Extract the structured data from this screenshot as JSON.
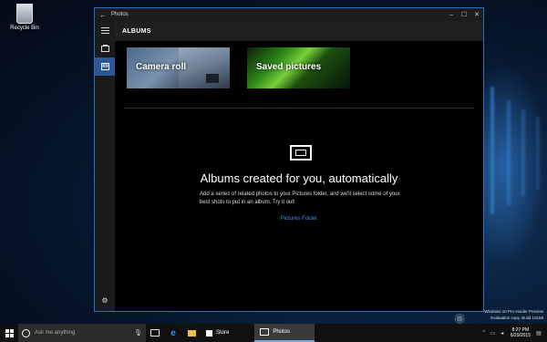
{
  "desktop": {
    "recycle_bin_label": "Recycle Bin"
  },
  "window": {
    "title": "Photos",
    "header": "ALBUMS",
    "tiles": [
      {
        "label": "Camera roll"
      },
      {
        "label": "Saved pictures"
      }
    ],
    "empty_state": {
      "title": "Albums created for you, automatically",
      "description": "Add a series of related photos to your Pictures folder, and we'll select some of your best shots to put in an album. Try it out!",
      "link": "Pictures Folder"
    }
  },
  "taskbar": {
    "search_placeholder": "Ask me anything",
    "apps": [
      {
        "label": "Store"
      },
      {
        "label": "Photos"
      }
    ],
    "clock_time": "8:27 PM",
    "clock_date": "6/29/2015"
  },
  "watermark": {
    "line1": "Windows 10 Pro Insider Preview",
    "line2": "Evaluation copy. Build 10158"
  },
  "colors": {
    "accent": "#2b5797",
    "link": "#3a8ee6",
    "window_border": "#2d6ec3"
  }
}
